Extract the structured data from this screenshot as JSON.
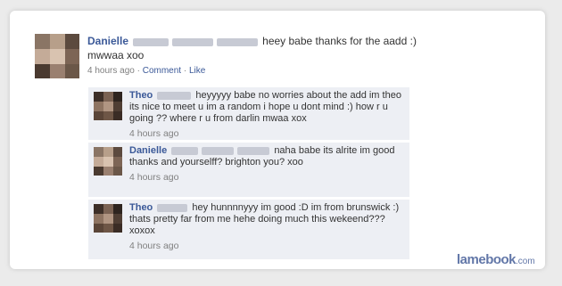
{
  "post": {
    "author": "Danielle",
    "message_inline": "heey babe thanks for the aadd :)",
    "message_line2": "mwwaa xoo",
    "time": "4 hours ago",
    "separator": "·",
    "comment_link": "Comment",
    "like_link": "Like"
  },
  "comments": [
    {
      "author": "Theo",
      "text": "heyyyyy babe no worries about the add im theo its nice to meet u im a random i hope u dont mind :) how r u going ?? where r u from darlin mwaa xox",
      "time": "4 hours ago"
    },
    {
      "author": "Danielle",
      "text": "naha babe its alrite im good thanks and yourselff? brighton you? xoo",
      "time": "4 hours ago"
    },
    {
      "author": "Theo",
      "text": "hey hunnnnyyy im good :D im from brunswick :) thats pretty far from me hehe doing much this wekeend??? xoxox",
      "time": "4 hours ago"
    }
  ],
  "watermark": {
    "brand": "lamebook",
    "tld": ".com"
  },
  "colors": {
    "name_link": "#3b5998",
    "comment_bg": "#edeff4",
    "page_bg": "#ebebeb"
  }
}
